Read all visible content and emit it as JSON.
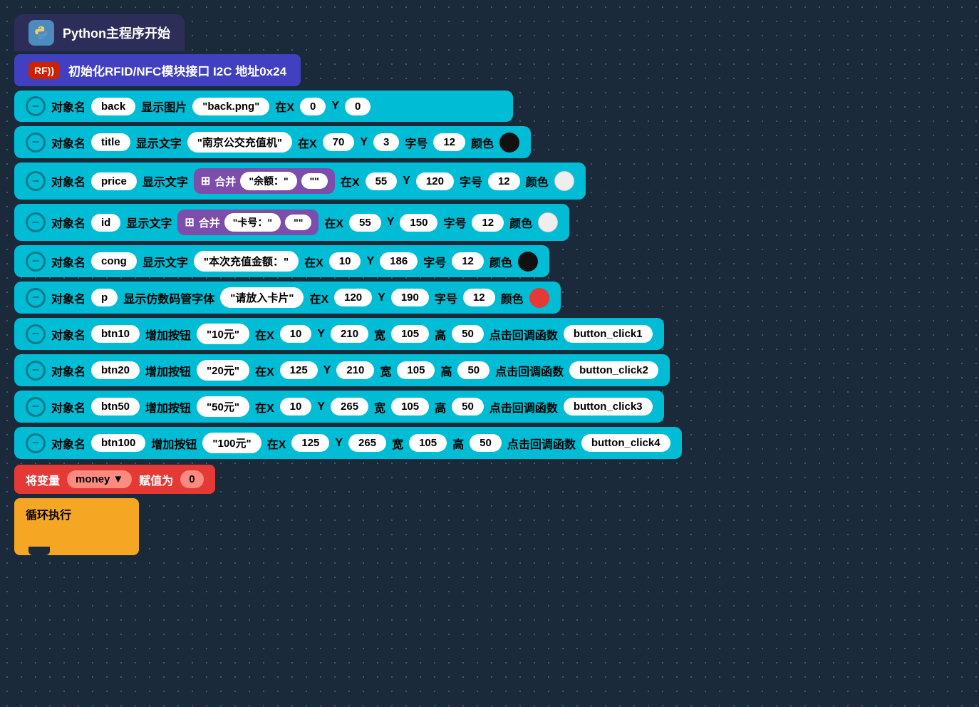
{
  "python_start": {
    "label": "Python主程序开始"
  },
  "rfid_block": {
    "badge": "RF))",
    "label": "初始化RFID/NFC模块接口 I2C 地址0x24"
  },
  "instructions": [
    {
      "id": "row1",
      "prefix": "对象名",
      "name": "back",
      "action": "显示图片",
      "quote_value": "\"back.png\"",
      "at_x": "在X",
      "x_val": "0",
      "at_y": "Y",
      "y_val": "0",
      "extras": []
    },
    {
      "id": "row2",
      "prefix": "对象名",
      "name": "title",
      "action": "显示文字",
      "quote_value": "\"南京公交充值机\"",
      "at_x": "在X",
      "x_val": "70",
      "at_y": "Y",
      "y_val": "3",
      "extras": [
        "字号",
        "12",
        "颜色",
        "black"
      ]
    },
    {
      "id": "row3",
      "prefix": "对象名",
      "name": "price",
      "action": "显示文字",
      "merge": true,
      "merge_label": "合并",
      "merge_v1": "\"余额：\"",
      "merge_v2": "\"\"",
      "at_x": "在X",
      "x_val": "55",
      "at_y": "Y",
      "y_val": "120",
      "extras": [
        "字号",
        "12",
        "颜色",
        "white"
      ]
    },
    {
      "id": "row4",
      "prefix": "对象名",
      "name": "id",
      "action": "显示文字",
      "merge": true,
      "merge_label": "合并",
      "merge_v1": "\"卡号：\"",
      "merge_v2": "\"\"",
      "at_x": "在X",
      "x_val": "55",
      "at_y": "Y",
      "y_val": "150",
      "extras": [
        "字号",
        "12",
        "颜色",
        "white"
      ]
    },
    {
      "id": "row5",
      "prefix": "对象名",
      "name": "cong",
      "action": "显示文字",
      "quote_value": "\"本次充值金额：\"",
      "at_x": "在X",
      "x_val": "10",
      "at_y": "Y",
      "y_val": "186",
      "extras": [
        "字号",
        "12",
        "颜色",
        "black"
      ]
    },
    {
      "id": "row6",
      "prefix": "对象名",
      "name": "p",
      "action": "显示仿数码管字体",
      "quote_value": "\"请放入卡片\"",
      "at_x": "在X",
      "x_val": "120",
      "at_y": "Y",
      "y_val": "190",
      "extras": [
        "字号",
        "12",
        "颜色",
        "red"
      ]
    },
    {
      "id": "row7",
      "prefix": "对象名",
      "name": "btn10",
      "action": "增加按钮",
      "quote_value": "\"10元\"",
      "at_x": "在X",
      "x_val": "10",
      "at_y": "Y",
      "y_val": "210",
      "extras": [
        "宽",
        "105",
        "高",
        "50",
        "点击回调函数",
        "button_click1"
      ]
    },
    {
      "id": "row8",
      "prefix": "对象名",
      "name": "btn20",
      "action": "增加按钮",
      "quote_value": "\"20元\"",
      "at_x": "在X",
      "x_val": "125",
      "at_y": "Y",
      "y_val": "210",
      "extras": [
        "宽",
        "105",
        "高",
        "50",
        "点击回调函数",
        "button_click2"
      ]
    },
    {
      "id": "row9",
      "prefix": "对象名",
      "name": "btn50",
      "action": "增加按钮",
      "quote_value": "\"50元\"",
      "at_x": "在X",
      "x_val": "10",
      "at_y": "Y",
      "y_val": "265",
      "extras": [
        "宽",
        "105",
        "高",
        "50",
        "点击回调函数",
        "button_click3"
      ]
    },
    {
      "id": "row10",
      "prefix": "对象名",
      "name": "btn100",
      "action": "增加按钮",
      "quote_value": "\"100元\"",
      "at_x": "在X",
      "x_val": "125",
      "at_y": "Y",
      "y_val": "265",
      "extras": [
        "宽",
        "105",
        "高",
        "50",
        "点击回调函数",
        "button_click4"
      ]
    }
  ],
  "var_set": {
    "label": "将变量",
    "var_name": "money",
    "assign_label": "赋值为",
    "value": "0"
  },
  "loop": {
    "label": "循环执行"
  },
  "labels": {
    "prefix": "对象名",
    "at_x": "在X",
    "at_y": "Y",
    "font_size": "字号",
    "color": "颜色",
    "merge": "合并",
    "width": "宽",
    "height": "高",
    "callback": "点击回调函数"
  }
}
